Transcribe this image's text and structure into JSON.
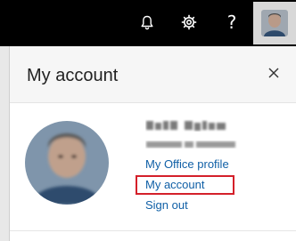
{
  "topbar": {
    "background": "#000000",
    "icons": [
      "bell-icon",
      "gear-icon",
      "help-icon"
    ],
    "help_glyph": "?"
  },
  "panel": {
    "title": "My account",
    "close_icon": "close-icon"
  },
  "user": {
    "name": "David Spiller",
    "email": "david@contoso.com"
  },
  "links": {
    "office_profile": "My Office profile",
    "my_account": "My account",
    "sign_out": "Sign out"
  },
  "colors": {
    "link": "#0f5fa6",
    "highlight": "#d4202a"
  }
}
